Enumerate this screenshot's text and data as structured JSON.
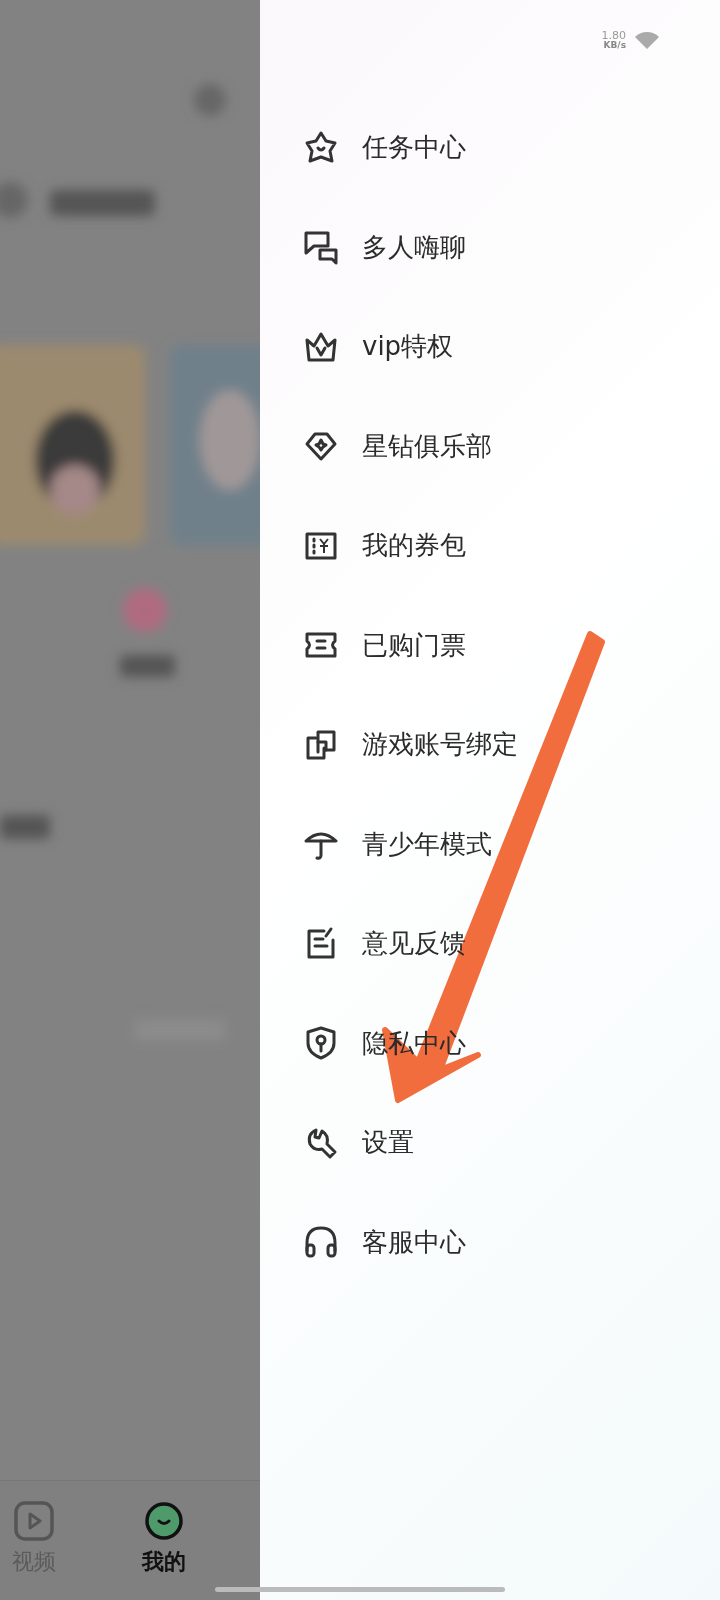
{
  "status_bar": {
    "speed": "1.80",
    "speed_unit": "KB/s"
  },
  "drawer": {
    "items": [
      {
        "label": "任务中心"
      },
      {
        "label": "多人嗨聊"
      },
      {
        "label": "vip特权"
      },
      {
        "label": "星钻俱乐部"
      },
      {
        "label": "我的券包"
      },
      {
        "label": "已购门票"
      },
      {
        "label": "游戏账号绑定"
      },
      {
        "label": "青少年模式"
      },
      {
        "label": "意见反馈"
      },
      {
        "label": "隐私中心"
      },
      {
        "label": "设置"
      },
      {
        "label": "客服中心"
      }
    ]
  },
  "bottom_nav": [
    {
      "label": "视频",
      "selected": false
    },
    {
      "label": "我的",
      "selected": true
    }
  ]
}
